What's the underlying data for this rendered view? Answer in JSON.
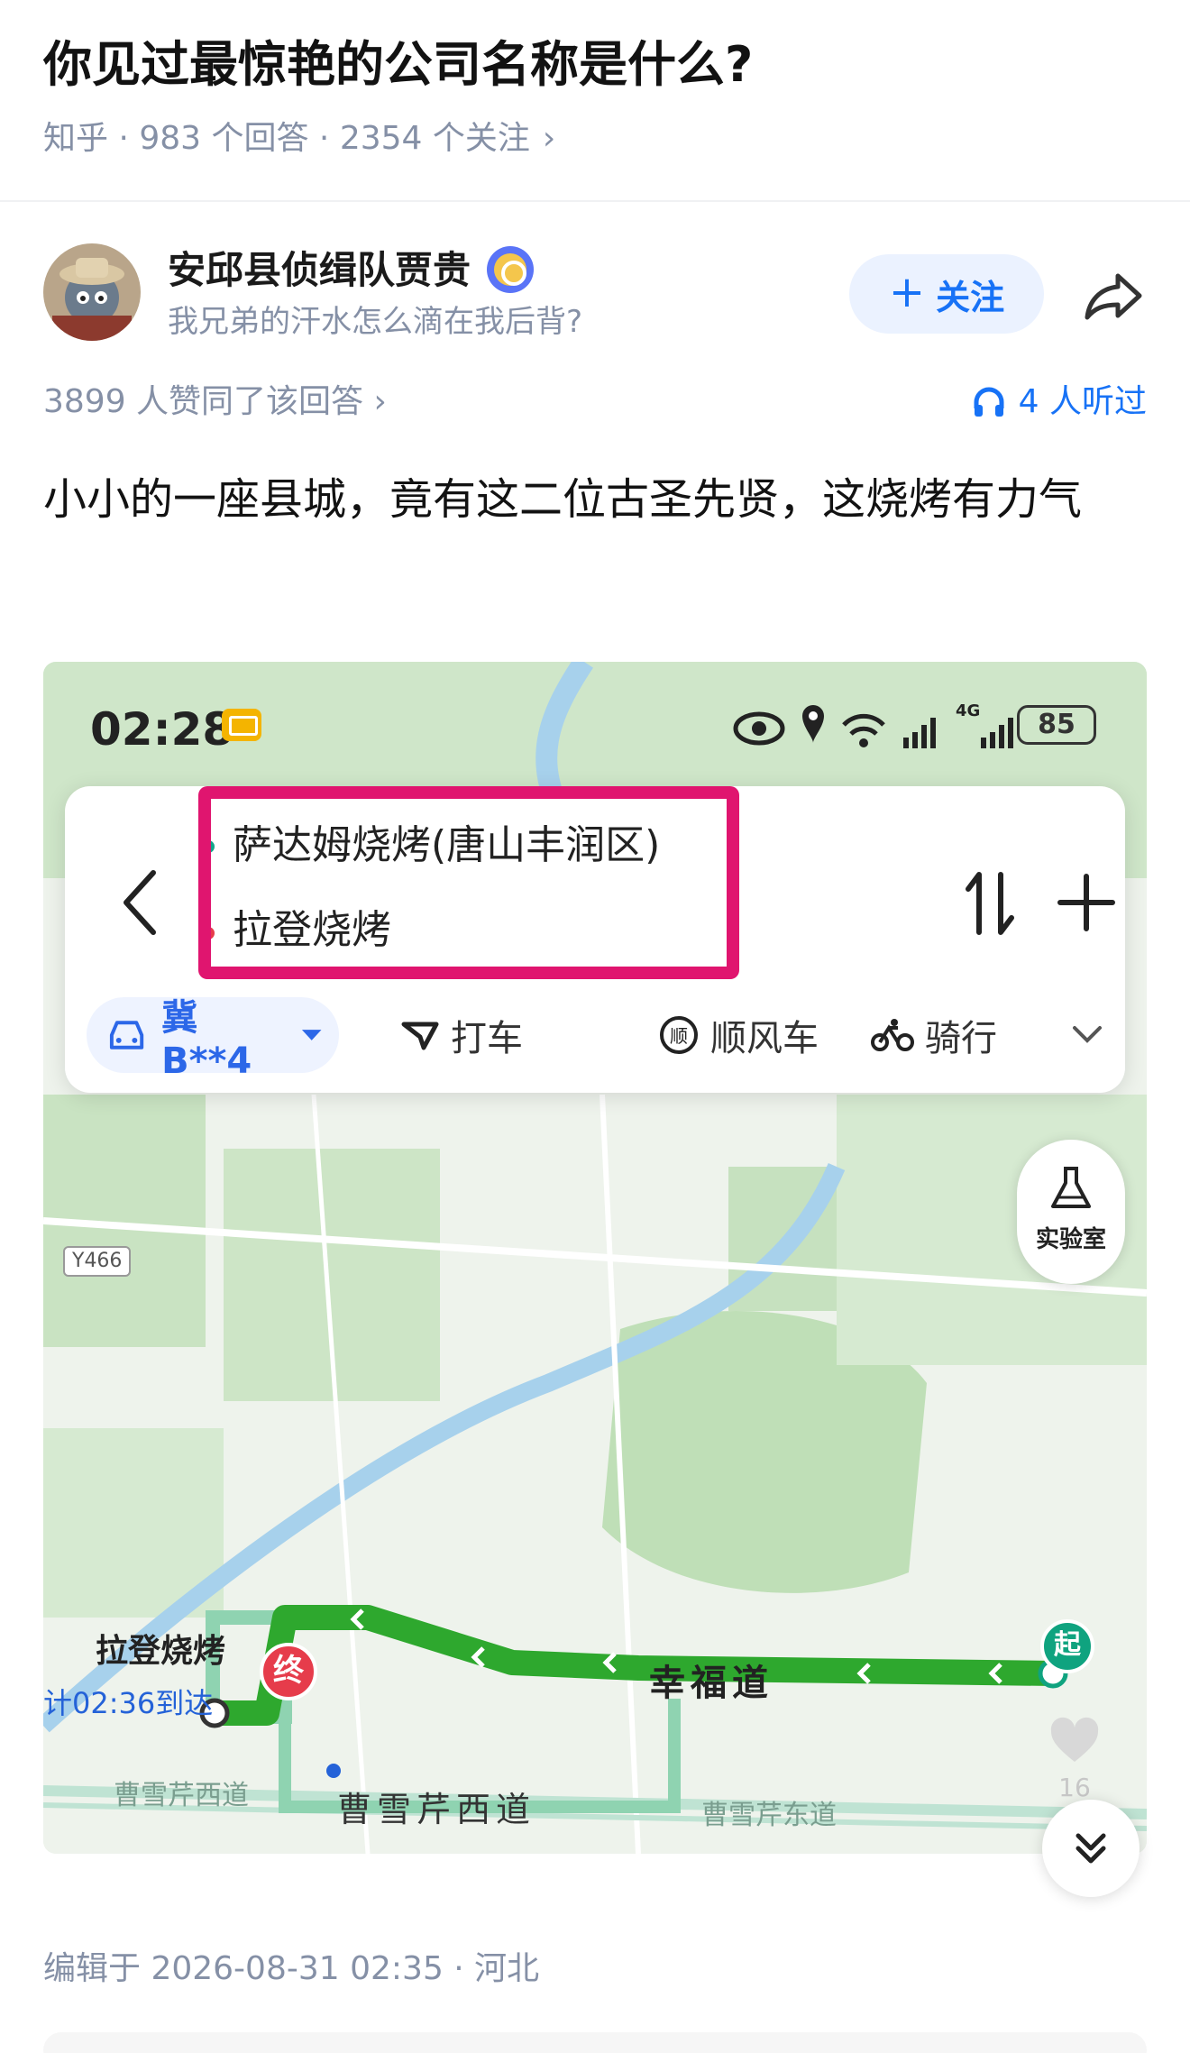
{
  "question": {
    "title": "你见过最惊艳的公司名称是什么?",
    "meta": "知乎 · 983 个回答 · 2354 个关注",
    "meta_chevron": "›"
  },
  "author": {
    "name": "安邱县侦缉队贾贵",
    "bio": "我兄弟的汗水怎么滴在我后背?",
    "follow_label": "关注",
    "follow_plus": "+"
  },
  "stats": {
    "votes": "3899 人赞同了该回答",
    "votes_chevron": "›",
    "listen": "4 人听过"
  },
  "answer": {
    "text": "小小的一座县城，竟有这二位古圣先贤，这烧烤有力气"
  },
  "map": {
    "status_time": "02:28",
    "battery": "85",
    "signal_label": "4G",
    "route_from": "萨达姆烧烤(唐山丰润区)",
    "route_to": "拉登烧烤",
    "plate": "冀B**4",
    "mode_taxi": "打车",
    "mode_carpool": "顺风车",
    "mode_bike": "骑行",
    "lab": "实验室",
    "road_tag": "Y466",
    "dest_name": "拉登烧烤",
    "eta": "计02:36到达",
    "end_label": "终",
    "start_label": "起",
    "road_main": "幸福道",
    "road_2": "曹雪芹西道",
    "road_gray1": "曹雪芹西道",
    "road_gray2": "曹雪芹东道",
    "like_count": "16"
  },
  "footer": {
    "edited": "编辑于 2026-08-31 02:35 · 河北"
  },
  "colors": {
    "accent": "#1772f6",
    "route": "#2ea82e",
    "highlight": "#e0156f",
    "meta": "#8590a6"
  }
}
